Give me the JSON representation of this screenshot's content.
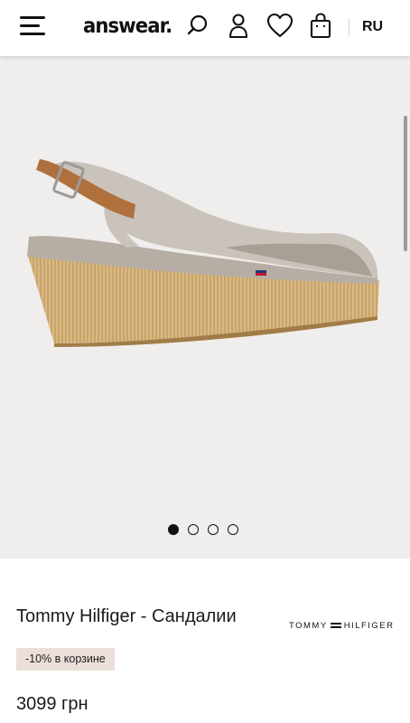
{
  "header": {
    "logo_text": "answear.",
    "menu_icon": "hamburger-menu-icon",
    "search_icon": "search-icon",
    "account_icon": "user-icon",
    "wishlist_icon": "heart-icon",
    "cart_icon": "shopping-bag-icon",
    "language": "RU"
  },
  "gallery": {
    "image_subject": "beige canvas wedge slingback sandal",
    "slides_total": 4,
    "active_slide": 1
  },
  "product": {
    "title": "Tommy Hilfiger - Сандалии",
    "brand_logo_left": "TOMMY",
    "brand_logo_right": "HILFIGER",
    "promo_badge": "-10% в корзине",
    "price": "3099 грн"
  }
}
